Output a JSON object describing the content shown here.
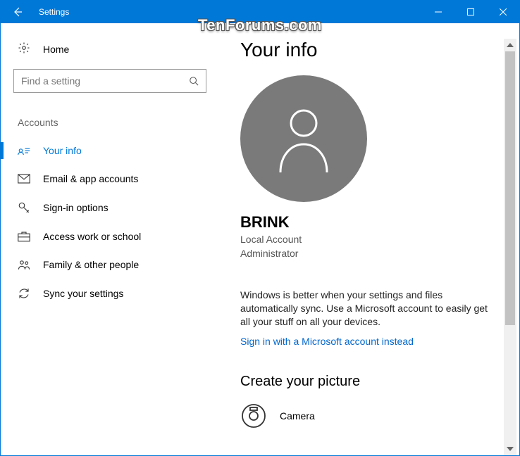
{
  "titlebar": {
    "title": "Settings"
  },
  "watermark": "TenForums.com",
  "sidebar": {
    "home_label": "Home",
    "search_placeholder": "Find a setting",
    "category": "Accounts",
    "items": [
      {
        "label": "Your info"
      },
      {
        "label": "Email & app accounts"
      },
      {
        "label": "Sign-in options"
      },
      {
        "label": "Access work or school"
      },
      {
        "label": "Family & other people"
      },
      {
        "label": "Sync your settings"
      }
    ]
  },
  "main": {
    "heading": "Your info",
    "username": "BRINK",
    "account_type": "Local Account",
    "role": "Administrator",
    "sync_blurb": "Windows is better when your settings and files automatically sync. Use a Microsoft account to easily get all your stuff on all your devices.",
    "ms_link": "Sign in with a Microsoft account instead",
    "picture_heading": "Create your picture",
    "picture_option": "Camera"
  }
}
